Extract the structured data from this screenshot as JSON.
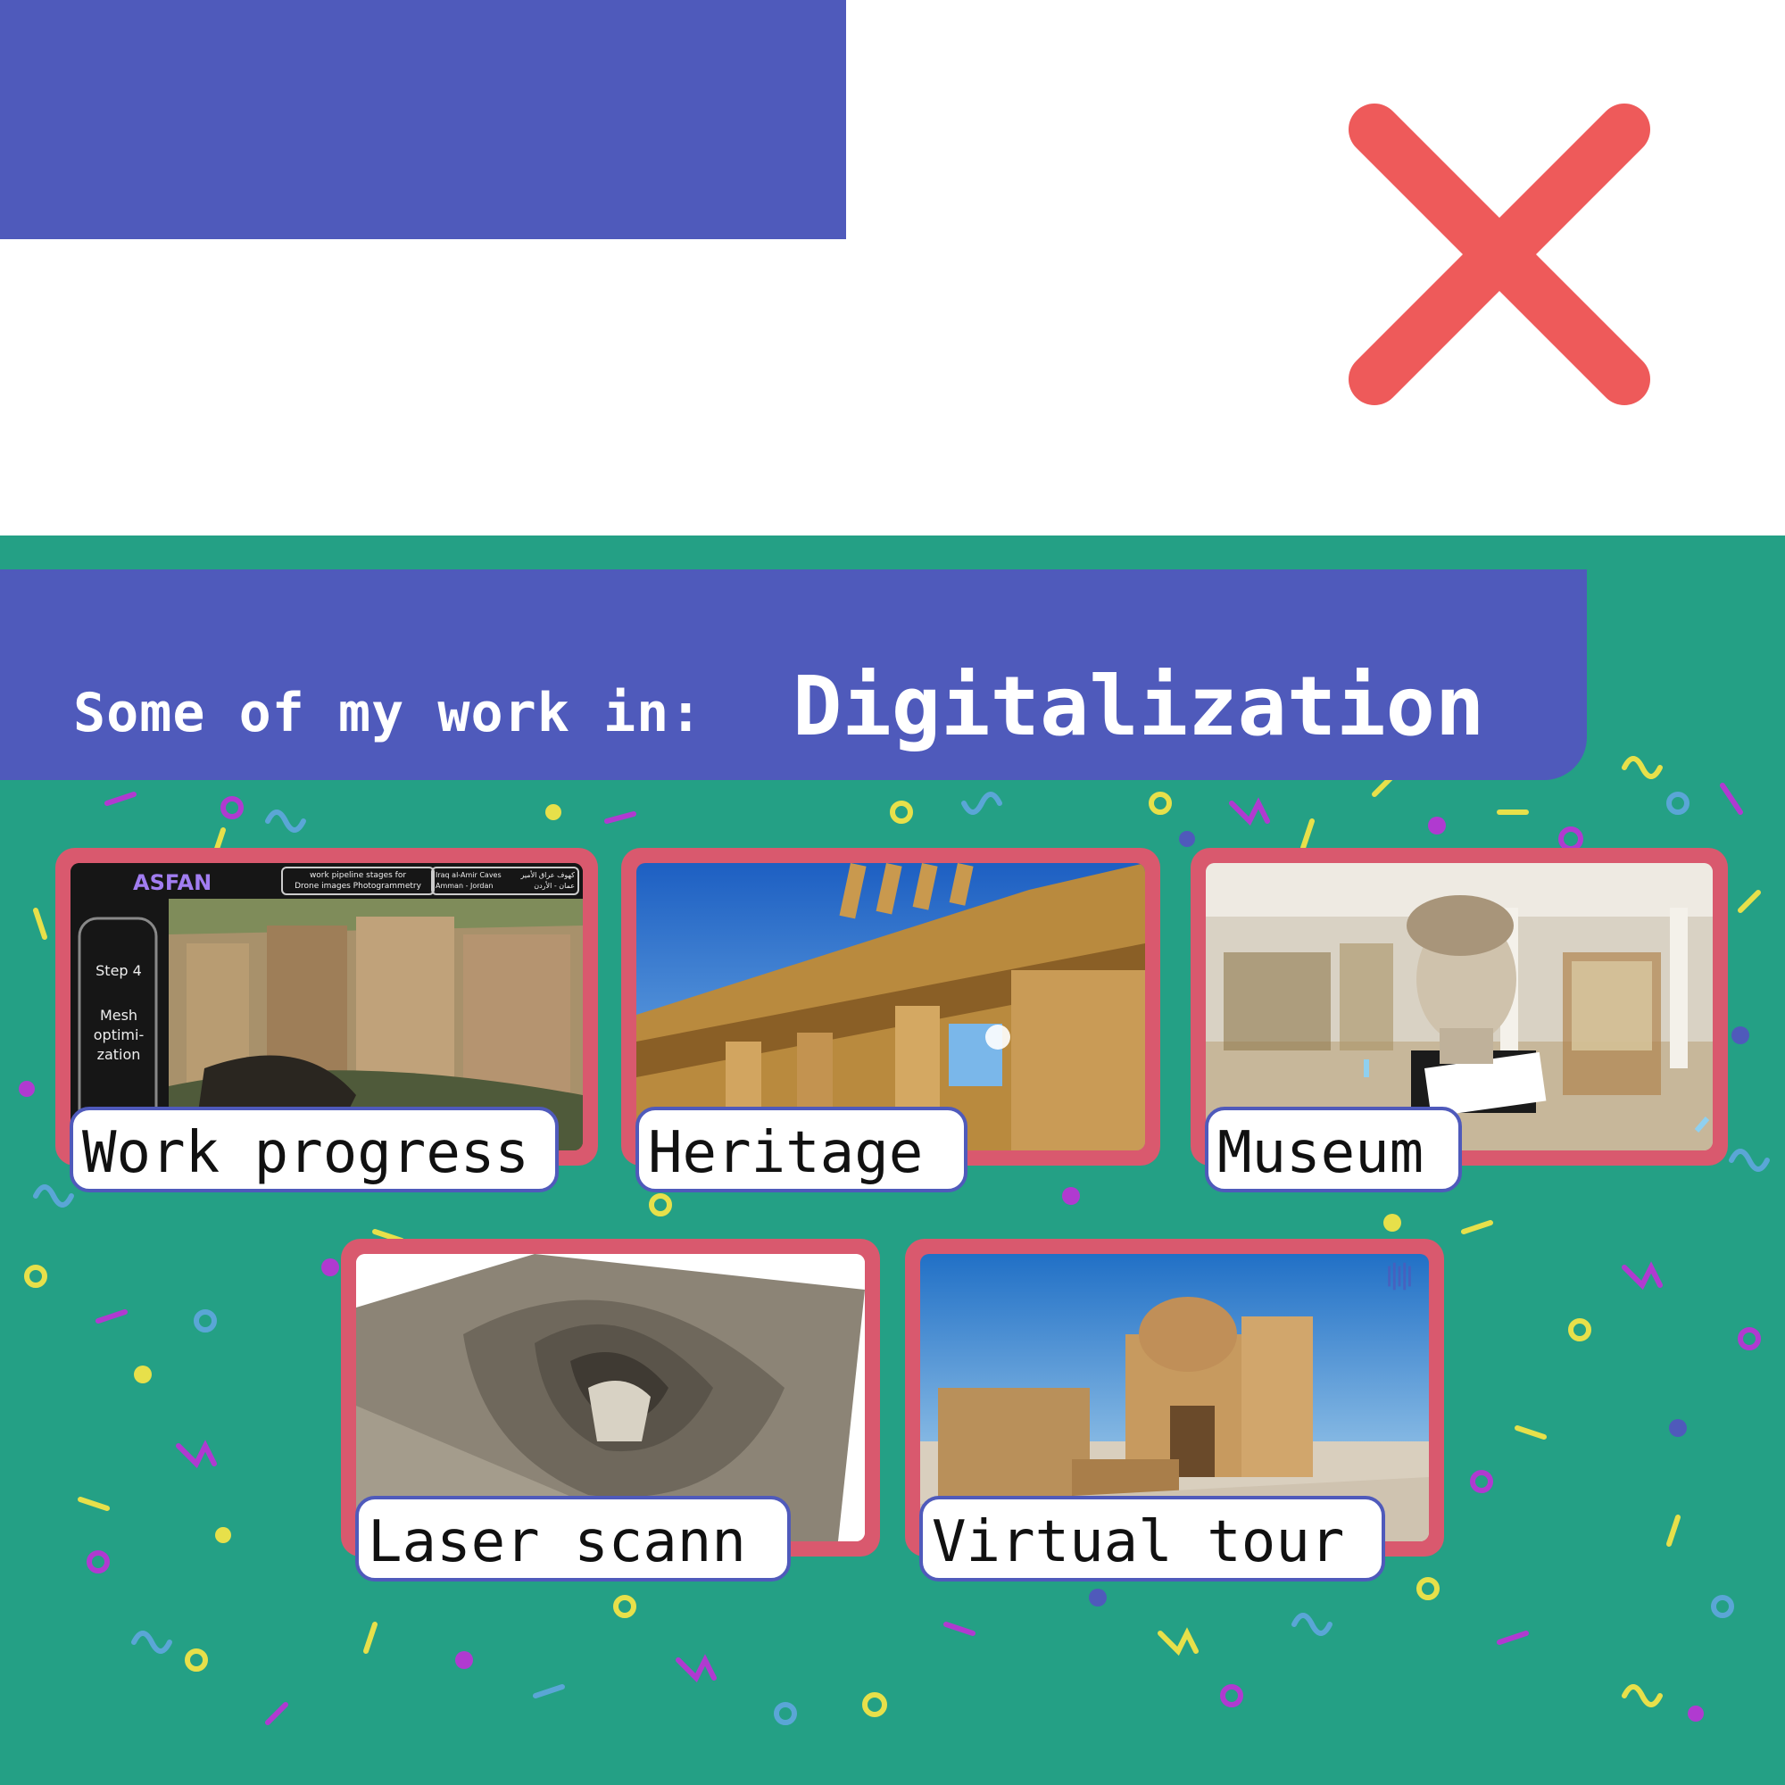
{
  "header": {
    "title_prefix": "Some of my work in:",
    "title_main": "Digitalization"
  },
  "close_icon": "close-x-icon",
  "colors": {
    "brand_blue": "#4f5abb",
    "teal_background": "#24a085",
    "card_frame": "#d9596e",
    "close_red": "#ee5a5a"
  },
  "cards": [
    {
      "label": "Work progress",
      "screen": {
        "brand": "ASFAN",
        "pipeline_title_1": "work pipeline stages for",
        "pipeline_title_2": "Drone images Photogrammetry",
        "location_1": "Iraq al-Amir Caves",
        "location_2": "Amman - Jordan",
        "arabic_1": "كهوف عراق الأمير",
        "arabic_2": "عمان - الأردن",
        "step": "Step 4",
        "stage_1": "Mesh",
        "stage_2": "optimi-",
        "stage_3": "zation"
      }
    },
    {
      "label": "Heritage"
    },
    {
      "label": "Museum"
    },
    {
      "label": "Laser scann"
    },
    {
      "label": "Virtual tour"
    }
  ]
}
